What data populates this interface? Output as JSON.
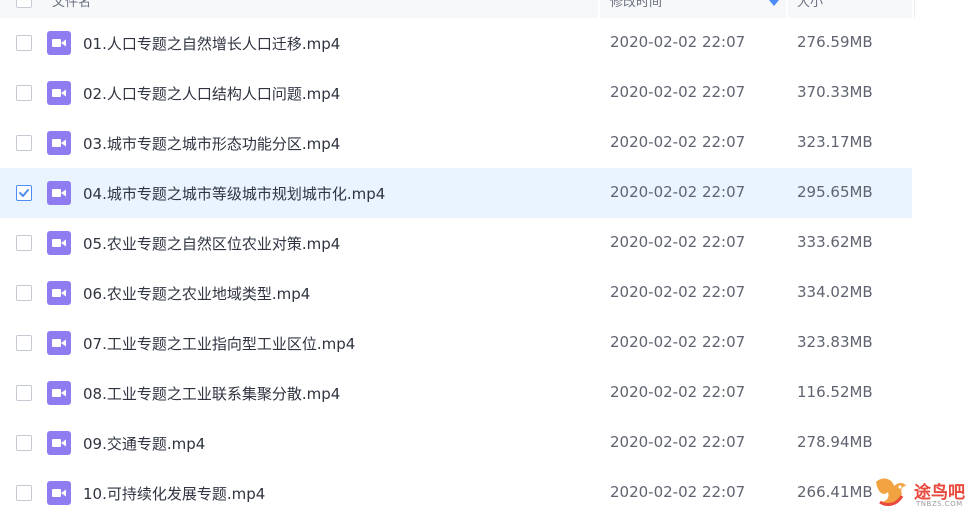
{
  "header": {
    "name_label": "文件名",
    "time_label": "修改时间",
    "size_label": "大小"
  },
  "files": [
    {
      "name": "01.人口专题之自然增长人口迁移.mp4",
      "modified": "2020-02-02 22:07",
      "size": "276.59MB",
      "selected": false
    },
    {
      "name": "02.人口专题之人口结构人口问题.mp4",
      "modified": "2020-02-02 22:07",
      "size": "370.33MB",
      "selected": false
    },
    {
      "name": "03.城市专题之城市形态功能分区.mp4",
      "modified": "2020-02-02 22:07",
      "size": "323.17MB",
      "selected": false
    },
    {
      "name": "04.城市专题之城市等级城市规划城市化.mp4",
      "modified": "2020-02-02 22:07",
      "size": "295.65MB",
      "selected": true
    },
    {
      "name": "05.农业专题之自然区位农业对策.mp4",
      "modified": "2020-02-02 22:07",
      "size": "333.62MB",
      "selected": false
    },
    {
      "name": "06.农业专题之农业地域类型.mp4",
      "modified": "2020-02-02 22:07",
      "size": "334.02MB",
      "selected": false
    },
    {
      "name": "07.工业专题之工业指向型工业区位.mp4",
      "modified": "2020-02-02 22:07",
      "size": "323.83MB",
      "selected": false
    },
    {
      "name": "08.工业专题之工业联系集聚分散.mp4",
      "modified": "2020-02-02 22:07",
      "size": "116.52MB",
      "selected": false
    },
    {
      "name": "09.交通专题.mp4",
      "modified": "2020-02-02 22:07",
      "size": "278.94MB",
      "selected": false
    },
    {
      "name": "10.可持续化发展专题.mp4",
      "modified": "2020-02-02 22:07",
      "size": "266.41MB",
      "selected": false
    }
  ],
  "icons": {
    "file_type": "video-file-icon",
    "sort": "sort-arrow-icon"
  },
  "colors": {
    "accent": "#4e8df5",
    "file_icon": "#8e7cf0",
    "selected_row": "#eaf4fe",
    "watermark": "#e8493c"
  },
  "watermark": {
    "title": "途鸟吧",
    "subtitle": "TNBZS.COM"
  }
}
